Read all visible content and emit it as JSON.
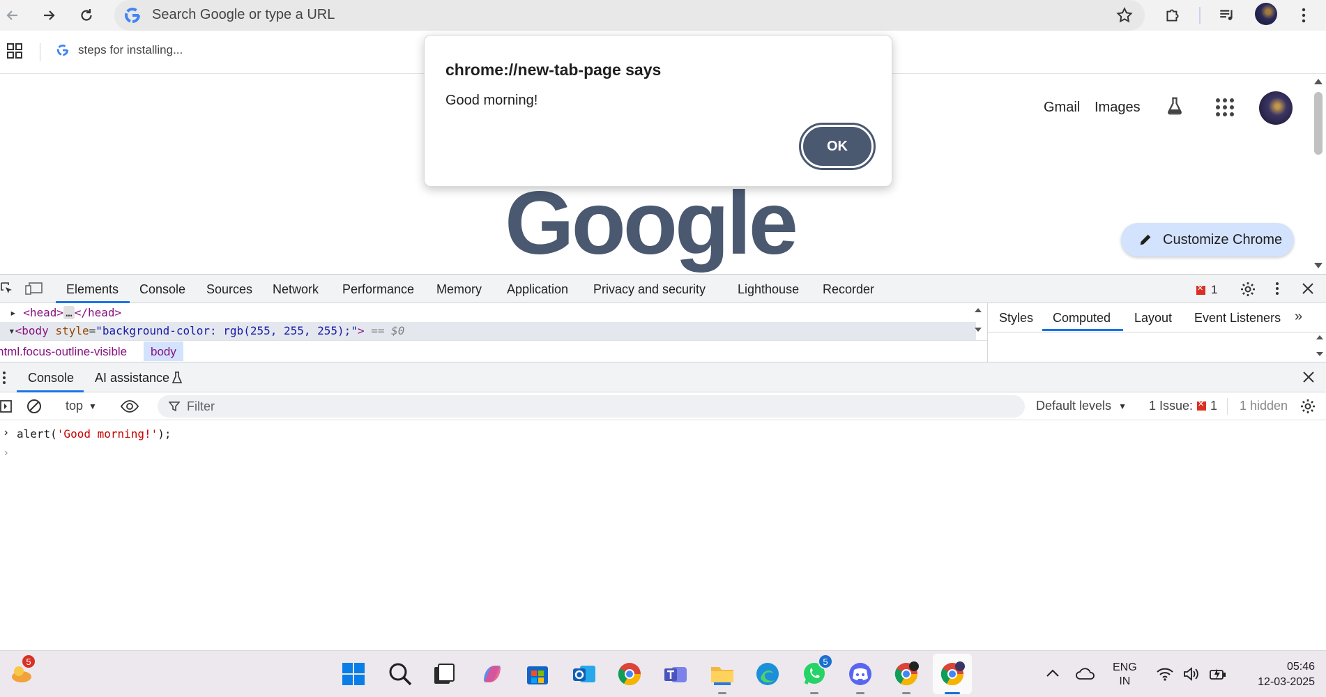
{
  "browser": {
    "omnibox_placeholder": "Search Google or type a URL",
    "bookmark_label": "steps for installing..."
  },
  "page": {
    "gmail": "Gmail",
    "images": "Images",
    "logo": "Google",
    "customize": "Customize Chrome"
  },
  "dialog": {
    "title": "chrome://new-tab-page says",
    "message": "Good morning!",
    "ok": "OK"
  },
  "devtools": {
    "tabs": [
      "Elements",
      "Console",
      "Sources",
      "Network",
      "Performance",
      "Memory",
      "Application",
      "Privacy and security",
      "Lighthouse",
      "Recorder"
    ],
    "issue_count": "1",
    "elements": {
      "head_open": "<head>",
      "head_close": "</head>",
      "ellipsis": "…",
      "body_tag": "<body",
      "body_attr": "style",
      "body_attr_value": "\"background-color: rgb(255, 255, 255);\"",
      "body_end": ">",
      "selected_marker": "== $0"
    },
    "breadcrumb": {
      "first": "html.focus-outline-visible",
      "second": "body"
    },
    "side_tabs": [
      "Styles",
      "Computed",
      "Layout",
      "Event Listeners"
    ],
    "drawer_tabs": {
      "console": "Console",
      "ai": "AI assistance"
    },
    "console_bar": {
      "context": "top",
      "filter_placeholder": "Filter",
      "levels": "Default levels",
      "issues_label": "1 Issue:",
      "issues_count": "1",
      "hidden": "1 hidden"
    },
    "console": {
      "fn": "alert(",
      "arg": "'Good morning!'",
      "end": ");"
    }
  },
  "taskbar": {
    "weather_badge": "5",
    "whatsapp_badge": "5",
    "lang_top": "ENG",
    "lang_bottom": "IN",
    "time": "05:46",
    "date": "12-03-2025"
  },
  "colors": {
    "accent": "#1a73e8",
    "dialog_button": "#4a5870",
    "customize_bg": "#d3e3fd",
    "error": "#d93025"
  }
}
